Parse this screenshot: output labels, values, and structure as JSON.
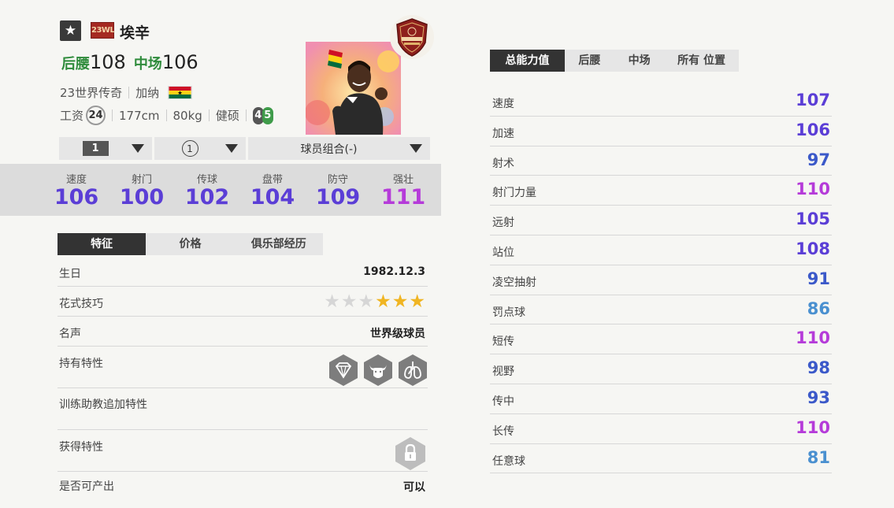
{
  "header": {
    "card_icon": "star-icon",
    "season_tag": "23WL",
    "name": "埃辛",
    "positions": [
      {
        "label": "后腰",
        "value": "108"
      },
      {
        "label": "中场",
        "value": "106"
      }
    ],
    "season_name": "23世界传奇",
    "nation": "加纳",
    "salary_label": "工资",
    "salary": "24",
    "height": "177cm",
    "weight": "80kg",
    "body_type": "健硕",
    "left_foot": "4",
    "right_foot": "5",
    "league_badge_icon": "world-legend-badge-icon",
    "colors": {
      "position_green": "#2e8b3b",
      "stat_purple": "#5b3ed6",
      "stat_pink": "#b53bd9"
    }
  },
  "selectors": {
    "level": "1",
    "adaptation": "1",
    "team_color": "球员组合(-)"
  },
  "stats": [
    {
      "label": "速度",
      "value": "106"
    },
    {
      "label": "射门",
      "value": "100"
    },
    {
      "label": "传球",
      "value": "102"
    },
    {
      "label": "盘带",
      "value": "104"
    },
    {
      "label": "防守",
      "value": "109"
    },
    {
      "label": "强壮",
      "value": "111"
    }
  ],
  "left_tabs": [
    "特征",
    "价格",
    "俱乐部经历"
  ],
  "info": {
    "birthday_label": "生日",
    "birthday": "1982.12.3",
    "skill_label": "花式技巧",
    "skill_stars": 3,
    "skill_stars_max": 6,
    "reputation_label": "名声",
    "reputation": "世界级球员",
    "traits_label": "持有特性",
    "trait_icons": [
      "diamond-icon",
      "bull-icon",
      "lungs-icon"
    ],
    "coach_traits_label": "训练助教追加特性",
    "acquired_label": "获得特性",
    "acquired_icon": "lock-icon",
    "tradable_label": "是否可产出",
    "tradable": "可以"
  },
  "right_tabs": [
    "总能力值",
    "后腰",
    "中场",
    "所有 位置"
  ],
  "attributes": [
    {
      "label": "速度",
      "value": "107",
      "color": "#5b3ed6"
    },
    {
      "label": "加速",
      "value": "106",
      "color": "#5b3ed6"
    },
    {
      "label": "射术",
      "value": "97",
      "color": "#3b59c9"
    },
    {
      "label": "射门力量",
      "value": "110",
      "color": "#b53bd9"
    },
    {
      "label": "远射",
      "value": "105",
      "color": "#5b3ed6"
    },
    {
      "label": "站位",
      "value": "108",
      "color": "#5b3ed6"
    },
    {
      "label": "凌空抽射",
      "value": "91",
      "color": "#3b59c9"
    },
    {
      "label": "罚点球",
      "value": "86",
      "color": "#4a90d0"
    },
    {
      "label": "短传",
      "value": "110",
      "color": "#b53bd9"
    },
    {
      "label": "视野",
      "value": "98",
      "color": "#3b59c9"
    },
    {
      "label": "传中",
      "value": "93",
      "color": "#3b59c9"
    },
    {
      "label": "长传",
      "value": "110",
      "color": "#b53bd9"
    },
    {
      "label": "任意球",
      "value": "81",
      "color": "#4a90d0"
    }
  ]
}
